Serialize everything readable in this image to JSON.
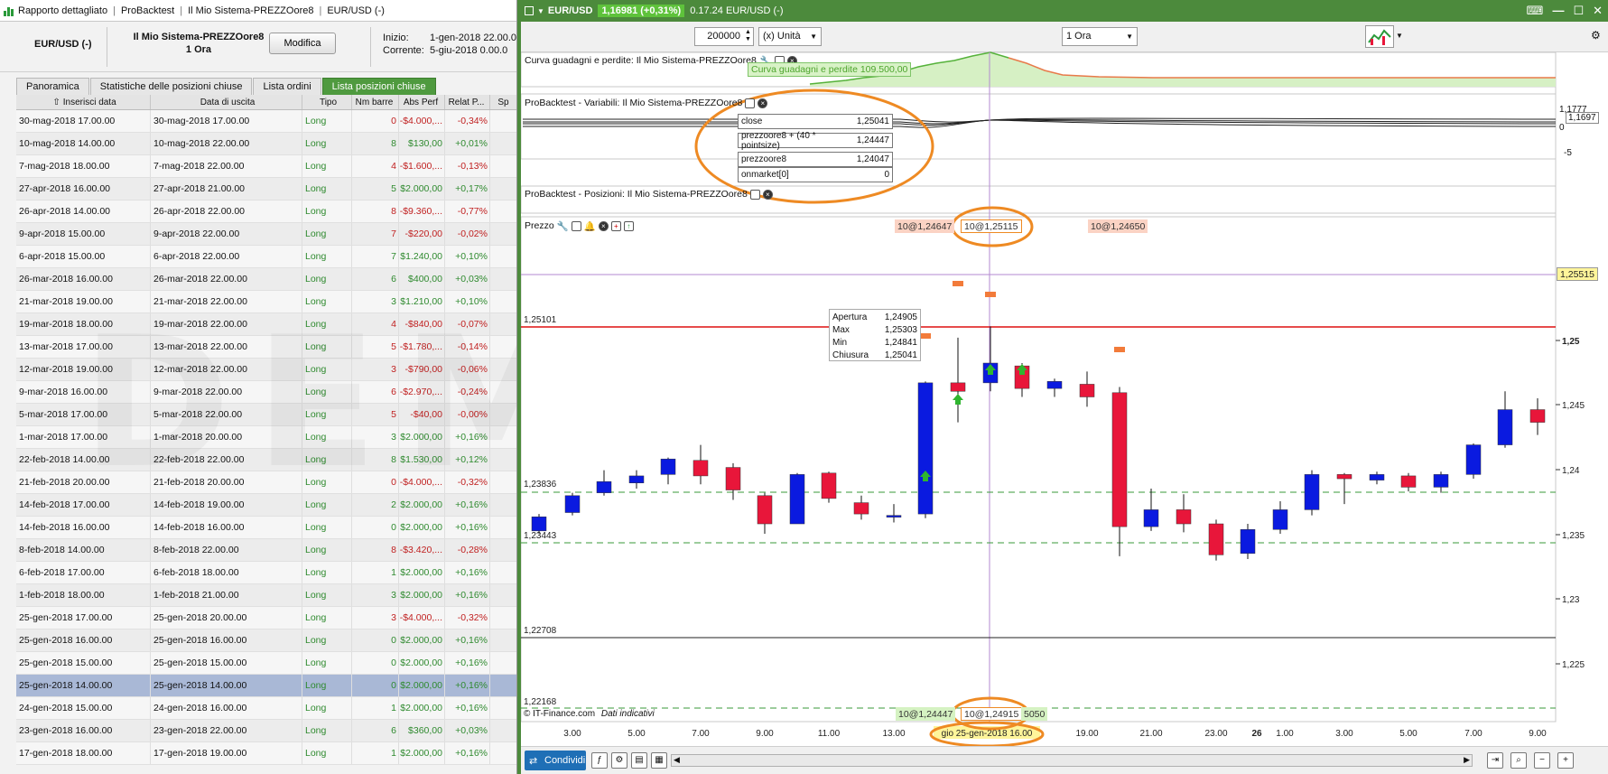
{
  "left_window": {
    "title_parts": [
      "Rapporto dettagliato",
      "ProBacktest",
      "Il Mio Sistema-PREZZOore8",
      "EUR/USD (-)"
    ],
    "instrument": "EUR/USD (-)",
    "system_name": "Il Mio Sistema-PREZZOore8",
    "system_timeframe": "1 Ora",
    "modify_label": "Modifica",
    "start_label": "Inizio:",
    "start_value": "1-gen-2018 22.00.0",
    "current_label": "Corrente:",
    "current_value": "5-giu-2018 0.00.0",
    "tabs": [
      "Panoramica",
      "Statistiche delle posizioni chiuse",
      "Lista ordini",
      "Lista posizioni chiuse"
    ],
    "active_tab": 3,
    "columns": [
      "Inserisci data",
      "Data di uscita",
      "Tipo",
      "Nm barre",
      "Abs Perf",
      "Relat P...",
      "Sp"
    ],
    "rows": [
      [
        "30-mag-2018 17.00.00",
        "30-mag-2018 17.00.00",
        "Long",
        "0",
        "-$4.000,...",
        "-0,34%"
      ],
      [
        "10-mag-2018 14.00.00",
        "10-mag-2018 22.00.00",
        "Long",
        "8",
        "$130,00",
        "+0,01%"
      ],
      [
        "7-mag-2018 18.00.00",
        "7-mag-2018 22.00.00",
        "Long",
        "4",
        "-$1.600,...",
        "-0,13%"
      ],
      [
        "27-apr-2018 16.00.00",
        "27-apr-2018 21.00.00",
        "Long",
        "5",
        "$2.000,00",
        "+0,17%"
      ],
      [
        "26-apr-2018 14.00.00",
        "26-apr-2018 22.00.00",
        "Long",
        "8",
        "-$9.360,...",
        "-0,77%"
      ],
      [
        "9-apr-2018 15.00.00",
        "9-apr-2018 22.00.00",
        "Long",
        "7",
        "-$220,00",
        "-0,02%"
      ],
      [
        "6-apr-2018 15.00.00",
        "6-apr-2018 22.00.00",
        "Long",
        "7",
        "$1.240,00",
        "+0,10%"
      ],
      [
        "26-mar-2018 16.00.00",
        "26-mar-2018 22.00.00",
        "Long",
        "6",
        "$400,00",
        "+0,03%"
      ],
      [
        "21-mar-2018 19.00.00",
        "21-mar-2018 22.00.00",
        "Long",
        "3",
        "$1.210,00",
        "+0,10%"
      ],
      [
        "19-mar-2018 18.00.00",
        "19-mar-2018 22.00.00",
        "Long",
        "4",
        "-$840,00",
        "-0,07%"
      ],
      [
        "13-mar-2018 17.00.00",
        "13-mar-2018 22.00.00",
        "Long",
        "5",
        "-$1.780,...",
        "-0,14%"
      ],
      [
        "12-mar-2018 19.00.00",
        "12-mar-2018 22.00.00",
        "Long",
        "3",
        "-$790,00",
        "-0,06%"
      ],
      [
        "9-mar-2018 16.00.00",
        "9-mar-2018 22.00.00",
        "Long",
        "6",
        "-$2.970,...",
        "-0,24%"
      ],
      [
        "5-mar-2018 17.00.00",
        "5-mar-2018 22.00.00",
        "Long",
        "5",
        "-$40,00",
        "-0,00%"
      ],
      [
        "1-mar-2018 17.00.00",
        "1-mar-2018 20.00.00",
        "Long",
        "3",
        "$2.000,00",
        "+0,16%"
      ],
      [
        "22-feb-2018 14.00.00",
        "22-feb-2018 22.00.00",
        "Long",
        "8",
        "$1.530,00",
        "+0,12%"
      ],
      [
        "21-feb-2018 20.00.00",
        "21-feb-2018 20.00.00",
        "Long",
        "0",
        "-$4.000,...",
        "-0,32%"
      ],
      [
        "14-feb-2018 17.00.00",
        "14-feb-2018 19.00.00",
        "Long",
        "2",
        "$2.000,00",
        "+0,16%"
      ],
      [
        "14-feb-2018 16.00.00",
        "14-feb-2018 16.00.00",
        "Long",
        "0",
        "$2.000,00",
        "+0,16%"
      ],
      [
        "8-feb-2018 14.00.00",
        "8-feb-2018 22.00.00",
        "Long",
        "8",
        "-$3.420,...",
        "-0,28%"
      ],
      [
        "6-feb-2018 17.00.00",
        "6-feb-2018 18.00.00",
        "Long",
        "1",
        "$2.000,00",
        "+0,16%"
      ],
      [
        "1-feb-2018 18.00.00",
        "1-feb-2018 21.00.00",
        "Long",
        "3",
        "$2.000,00",
        "+0,16%"
      ],
      [
        "25-gen-2018 17.00.00",
        "25-gen-2018 20.00.00",
        "Long",
        "3",
        "-$4.000,...",
        "-0,32%"
      ],
      [
        "25-gen-2018 16.00.00",
        "25-gen-2018 16.00.00",
        "Long",
        "0",
        "$2.000,00",
        "+0,16%"
      ],
      [
        "25-gen-2018 15.00.00",
        "25-gen-2018 15.00.00",
        "Long",
        "0",
        "$2.000,00",
        "+0,16%"
      ],
      [
        "25-gen-2018 14.00.00",
        "25-gen-2018 14.00.00",
        "Long",
        "0",
        "$2.000,00",
        "+0,16%"
      ],
      [
        "24-gen-2018 15.00.00",
        "24-gen-2018 16.00.00",
        "Long",
        "1",
        "$2.000,00",
        "+0,16%"
      ],
      [
        "23-gen-2018 16.00.00",
        "23-gen-2018 22.00.00",
        "Long",
        "6",
        "$360,00",
        "+0,03%"
      ],
      [
        "17-gen-2018 18.00.00",
        "17-gen-2018 19.00.00",
        "Long",
        "1",
        "$2.000,00",
        "+0,16%"
      ]
    ],
    "selected_row": 25,
    "watermark": "DEMO VERSION"
  },
  "right_window": {
    "symbol": "EUR/USD",
    "price_badge": "1,16981 (+0,31%)",
    "time_info": "0.17.24 EUR/USD (-)",
    "quantity": "200000",
    "unit_select": "(x) Unità",
    "timeframe_select": "1 Ora",
    "panel_equity_title": "Curva guadagni e perdite: Il Mio Sistema-PREZZOore8",
    "equity_tag": "Curva guadagni e perdite  109.500,00",
    "panel_vars_title": "ProBacktest - Variabili: Il Mio Sistema-PREZZOore8",
    "vars_axis": [
      "1,1777",
      "1,1697",
      "0",
      "-5"
    ],
    "variables": [
      {
        "name": "close",
        "value": "1,25041"
      },
      {
        "name": "prezzoore8 + (40 * pointsize)",
        "value": "1,24447"
      },
      {
        "name": "prezzoore8",
        "value": "1,24047"
      },
      {
        "name": "onmarket[0]",
        "value": "0"
      }
    ],
    "panel_positions_title": "ProBacktest - Posizioni: Il Mio Sistema-PREZZOore8",
    "price_panel_title": "Prezzo",
    "order_tags_top": [
      "10@1,24647",
      "10@1,25115",
      "10@1,24650"
    ],
    "order_tags_bottom": [
      "10@1,24447",
      "10@1,24915",
      "5050"
    ],
    "level_labels": [
      "1,25101",
      "1,23836",
      "1,23443",
      "1,22708",
      "1,22168"
    ],
    "price_axis": [
      "1,25",
      "1,245",
      "1,24",
      "1,235",
      "1,23",
      "1,225"
    ],
    "crosshair_price": "1,25515",
    "ohlc": [
      {
        "label": "Apertura",
        "value": "1,24905"
      },
      {
        "label": "Max",
        "value": "1,25303"
      },
      {
        "label": "Min",
        "value": "1,24841"
      },
      {
        "label": "Chiusura",
        "value": "1,25041"
      }
    ],
    "time_axis": [
      "3.00",
      "5.00",
      "7.00",
      "9.00",
      "11.00",
      "13.00",
      "gio 25-gen-2018 16.00",
      "19.00",
      "21.00",
      "23.00",
      "26",
      "1.00",
      "3.00",
      "5.00",
      "7.00",
      "9.00"
    ],
    "footer_text": "© IT-Finance.com",
    "footer_italic": "Dati indicativi",
    "share_label": "Condividi",
    "colors": {
      "accent_green": "#4c8a3c",
      "bull": "#0a1ae0",
      "bear": "#e8163a",
      "annotation": "#ee8a23"
    }
  }
}
